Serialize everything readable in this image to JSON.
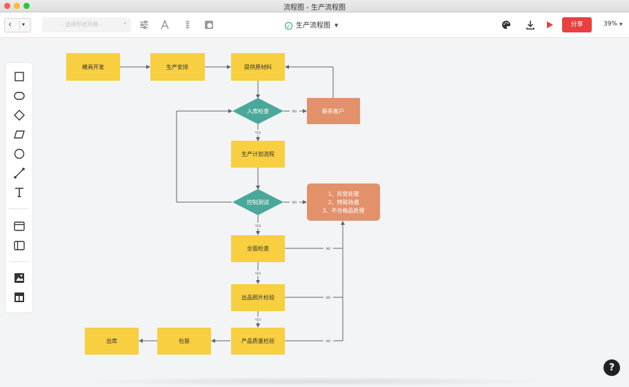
{
  "window": {
    "title": "流程图 - 生产流程图"
  },
  "toolbar": {
    "shape_style_placeholder": "- 选择形状风格 -",
    "document_title": "生产流程图",
    "share_label": "分享",
    "zoom": "39%"
  },
  "icons": {
    "back": "chevron-left-icon",
    "format": "sliders-icon",
    "text_style": "font-a-icon",
    "fill": "fill-pattern-icon",
    "opacity": "opacity-icon",
    "saved": "check-circle-icon",
    "theme": "palette-icon",
    "download": "download-icon",
    "present": "play-icon",
    "help": "question-icon"
  },
  "left_tools": [
    "rectangle-tool",
    "rounded-rectangle-tool",
    "diamond-tool",
    "parallelogram-tool",
    "circle-tool",
    "line-tool",
    "text-tool",
    "container-tool",
    "swimlane-tool",
    "image-tool",
    "table-tool"
  ],
  "help": {
    "label": "?"
  },
  "flowchart": {
    "nodes": {
      "mold": "模具开发",
      "schedule": "生产安排",
      "material": "提供原材料",
      "inbound": "入库检查",
      "contact": "联系客户",
      "plan": "生产计划流程",
      "control": "控制测试",
      "exception": [
        "1、异常处理",
        "2、特殊待遇",
        "3、不合格品处理"
      ],
      "full_check": "全面检查",
      "photo_check": "出品照片检验",
      "quality_check": "产品质量检验",
      "packing": "包装",
      "outbound": "出库"
    },
    "edge_labels": {
      "inbound_no": "NO",
      "inbound_yes": "YES",
      "control_no": "NO",
      "control_yes": "YES",
      "full_no": "NO",
      "full_yes": "YES",
      "photo_no": "NO",
      "photo_yes": "YES",
      "quality_no": "NO"
    },
    "colors": {
      "yellow": "#f7cf40",
      "teal": "#4aa89a",
      "salmon": "#e3916b",
      "line": "#5b6670"
    }
  }
}
